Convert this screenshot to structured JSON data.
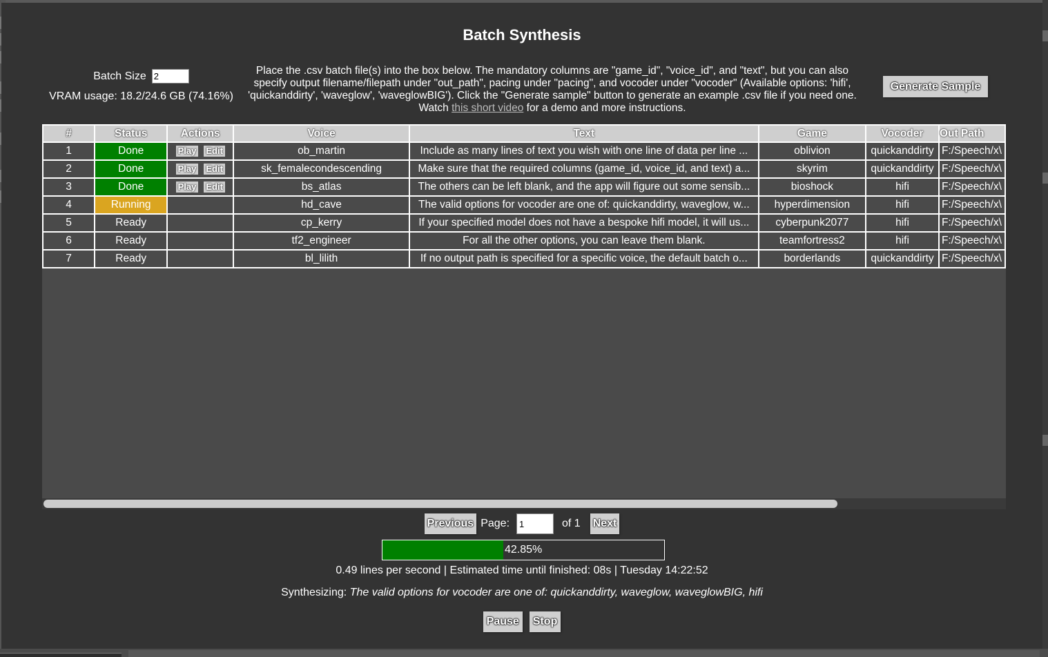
{
  "title": "Batch Synthesis",
  "batch_size": {
    "label": "Batch Size",
    "value": "2"
  },
  "vram_usage": "VRAM usage: 18.2/24.6 GB (74.16%)",
  "instructions": {
    "before_link": "Place the .csv batch file(s) into the box below. The mandatory columns are \"game_id\", \"voice_id\", and \"text\", but you can also specify output filename/filepath under \"out_path\", pacing under \"pacing\", and vocoder under \"vocoder\" (Available options: 'hifi', 'quickanddirty', 'waveglow', 'waveglowBIG'). Click the \"Generate sample\" button to generate an example .csv file if you need one. Watch ",
    "link_text": "this short video",
    "after_link": " for a demo and more instructions."
  },
  "generate_sample_label": "Generate Sample",
  "table": {
    "columns": [
      "#",
      "Status",
      "Actions",
      "Voice",
      "Text",
      "Game",
      "Vocoder",
      "Out Path"
    ],
    "action_labels": {
      "play": "Play",
      "edit": "Edit"
    },
    "rows": [
      {
        "num": "1",
        "status": "Done",
        "has_actions": true,
        "voice": "ob_martin",
        "text": "Include as many lines of text you wish with one line of data per line ...",
        "game": "oblivion",
        "vocoder": "quickanddirty",
        "out_path": "F:/Speech/x\\"
      },
      {
        "num": "2",
        "status": "Done",
        "has_actions": true,
        "voice": "sk_femalecondescending",
        "text": "Make sure that the required columns (game_id, voice_id, and text) a...",
        "game": "skyrim",
        "vocoder": "quickanddirty",
        "out_path": "F:/Speech/x\\"
      },
      {
        "num": "3",
        "status": "Done",
        "has_actions": true,
        "voice": "bs_atlas",
        "text": "The others can be left blank, and the app will figure out some sensib...",
        "game": "bioshock",
        "vocoder": "hifi",
        "out_path": "F:/Speech/x\\"
      },
      {
        "num": "4",
        "status": "Running",
        "has_actions": false,
        "voice": "hd_cave",
        "text": "The valid options for vocoder are one of: quickanddirty, waveglow, w...",
        "game": "hyperdimension",
        "vocoder": "hifi",
        "out_path": "F:/Speech/x\\"
      },
      {
        "num": "5",
        "status": "Ready",
        "has_actions": false,
        "voice": "cp_kerry",
        "text": "If your specified model does not have a bespoke hifi model, it will us...",
        "game": "cyberpunk2077",
        "vocoder": "hifi",
        "out_path": "F:/Speech/x\\"
      },
      {
        "num": "6",
        "status": "Ready",
        "has_actions": false,
        "voice": "tf2_engineer",
        "text": "For all the other options, you can leave them blank.",
        "game": "teamfortress2",
        "vocoder": "hifi",
        "out_path": "F:/Speech/x\\"
      },
      {
        "num": "7",
        "status": "Ready",
        "has_actions": false,
        "voice": "bl_lilith",
        "text": "If no output path is specified for a specific voice, the default batch o...",
        "game": "borderlands",
        "vocoder": "quickanddirty",
        "out_path": "F:/Speech/x\\"
      }
    ]
  },
  "status_colors": {
    "Done": "#008000",
    "Running": "#daa520",
    "Ready": "#4a4a4a"
  },
  "pagination": {
    "previous_label": "Previous",
    "page_label": "Page:",
    "page_value": "1",
    "of_label": "of 1",
    "next_label": "Next"
  },
  "progress": {
    "percent": 42.85,
    "label": "42.85%",
    "color": "#008000"
  },
  "stats": "0.49 lines per second | Estimated time until finished: 08s | Tuesday 14:22:52",
  "synthesizing": {
    "label": "Synthesizing: ",
    "text": "The valid options for vocoder are one of: quickanddirty, waveglow, waveglowBIG, hifi"
  },
  "controls": {
    "pause_label": "Pause",
    "stop_label": "Stop"
  }
}
